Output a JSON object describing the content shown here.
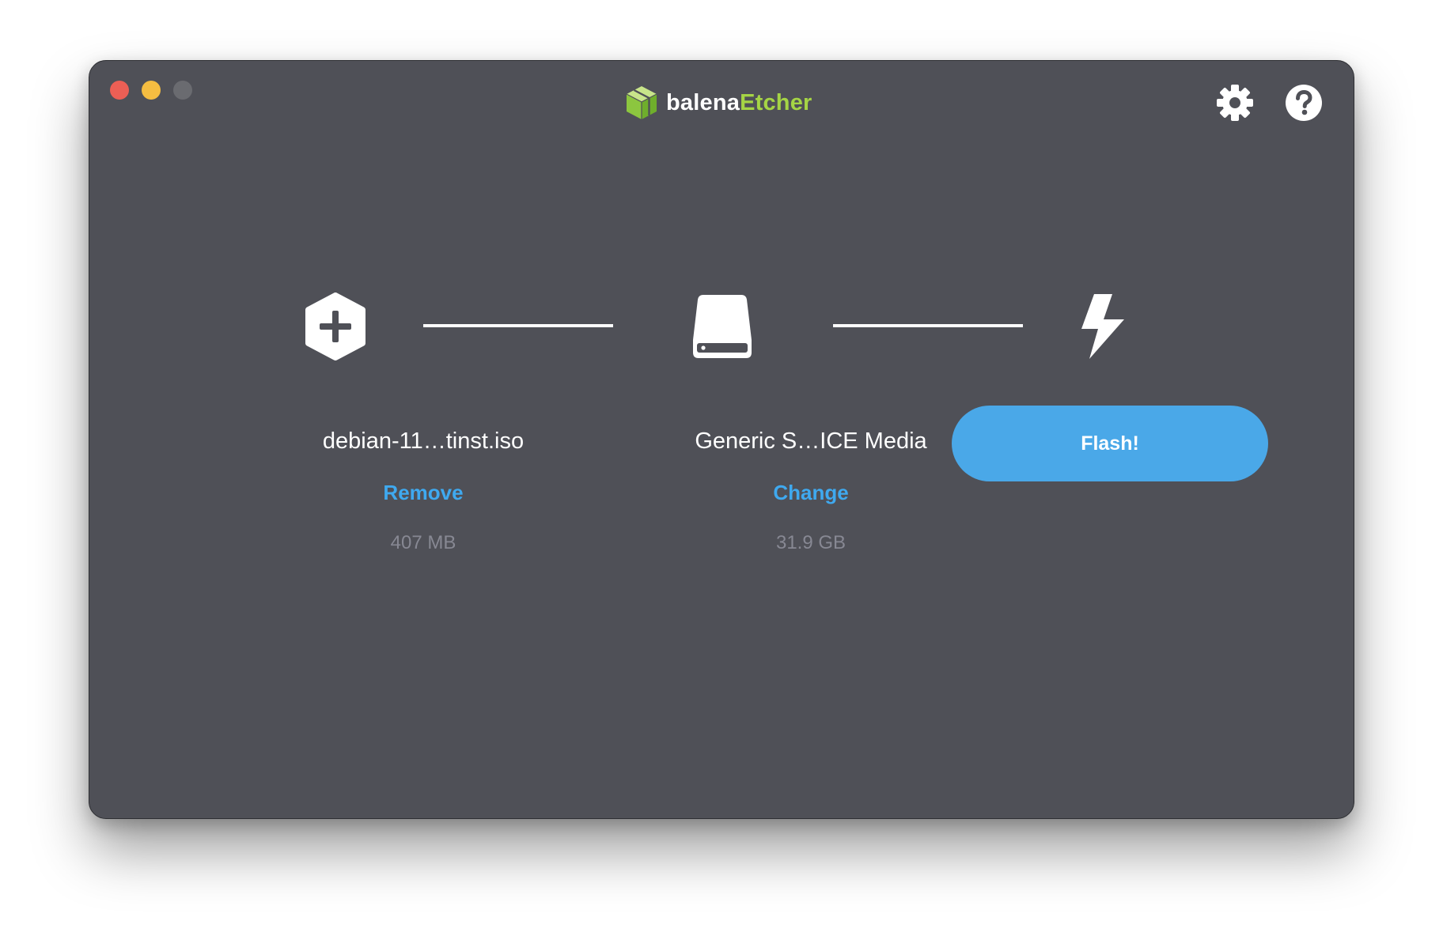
{
  "window": {
    "controls": {
      "close_color": "#ec5f55",
      "minimize_color": "#f5bd41",
      "maximize_color": "#6a6b70"
    }
  },
  "header": {
    "logo_prefix": "balena",
    "logo_suffix": "Etcher",
    "logo_accent_color": "#a5d445",
    "settings_icon": "gear-icon",
    "help_icon": "question-circle-icon"
  },
  "steps": {
    "source": {
      "icon": "hexagon-plus-icon",
      "name": "debian-11…tinst.iso",
      "action_label": "Remove",
      "size": "407 MB"
    },
    "target": {
      "icon": "drive-icon",
      "name": "Generic S…ICE Media",
      "action_label": "Change",
      "size": "31.9 GB"
    },
    "flash": {
      "icon": "lightning-bolt-icon",
      "button_label": "Flash!"
    }
  },
  "colors": {
    "window_bg": "#4f5057",
    "link": "#3fa9ef",
    "button": "#4aa8e8",
    "muted_text": "#878893"
  }
}
